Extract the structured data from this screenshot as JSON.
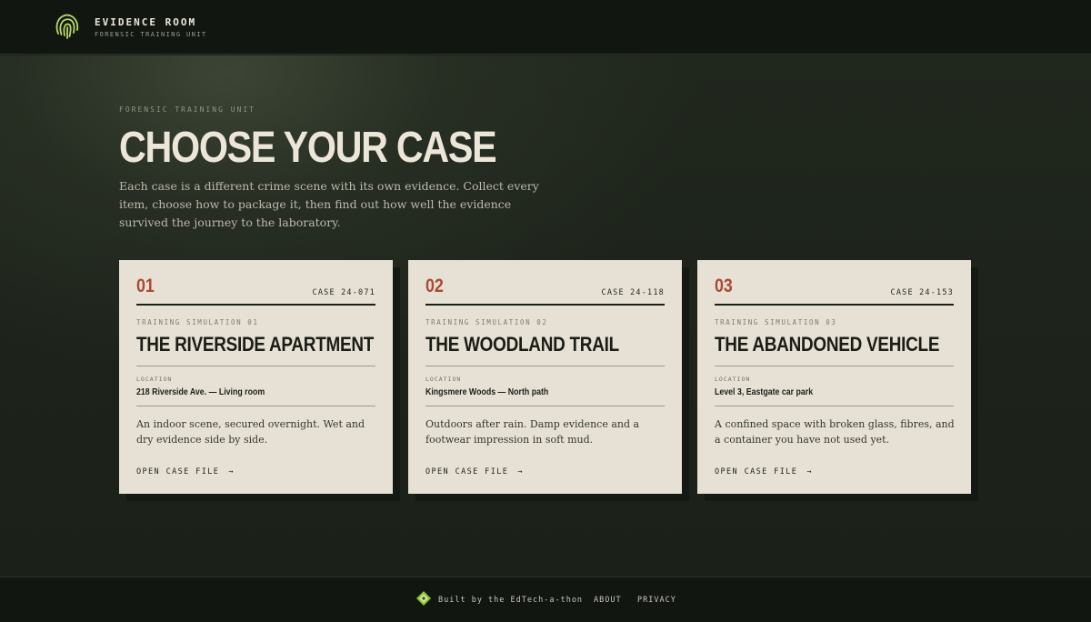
{
  "brand": {
    "title": "EVIDENCE ROOM",
    "subtitle": "FORENSIC TRAINING UNIT",
    "accent_color": "#b9d96a"
  },
  "hero": {
    "eyebrow": "FORENSIC TRAINING UNIT",
    "title": "CHOOSE YOUR CASE",
    "description": "Each case is a different crime scene with its own evidence. Collect every item, choose how to package it, then find out how well the evidence survived the journey to the laboratory."
  },
  "cases": [
    {
      "number": "01",
      "code": "CASE 24-071",
      "simulation": "TRAINING SIMULATION 01",
      "title": "THE RIVERSIDE APARTMENT",
      "location_label": "LOCATION",
      "location": "218 Riverside Ave. — Living room",
      "description": "An indoor scene, secured overnight. Wet and dry evidence side by side.",
      "link": "OPEN CASE FILE",
      "arrow": "→"
    },
    {
      "number": "02",
      "code": "CASE 24-118",
      "simulation": "TRAINING SIMULATION 02",
      "title": "THE WOODLAND TRAIL",
      "location_label": "LOCATION",
      "location": "Kingsmere Woods — North path",
      "description": "Outdoors after rain. Damp evidence and a footwear impression in soft mud.",
      "link": "OPEN CASE FILE",
      "arrow": "→"
    },
    {
      "number": "03",
      "code": "CASE 24-153",
      "simulation": "TRAINING SIMULATION 03",
      "title": "THE ABANDONED VEHICLE",
      "location_label": "LOCATION",
      "location": "Level 3, Eastgate car park",
      "description": "A confined space with broken glass, fibres, and a container you have not used yet.",
      "link": "OPEN CASE FILE",
      "arrow": "→"
    }
  ],
  "footer": {
    "credit": "Built by the EdTech-a-thon",
    "about": "ABOUT",
    "privacy": "PRIVACY"
  },
  "colors": {
    "case_number": "#a94a35",
    "card_background": "#e7e1d5",
    "page_background": "#1d2219"
  },
  "icons": {
    "brand": "fingerprint-icon",
    "footer": "diamond-logo-icon",
    "link_arrow": "arrow-right-icon"
  }
}
